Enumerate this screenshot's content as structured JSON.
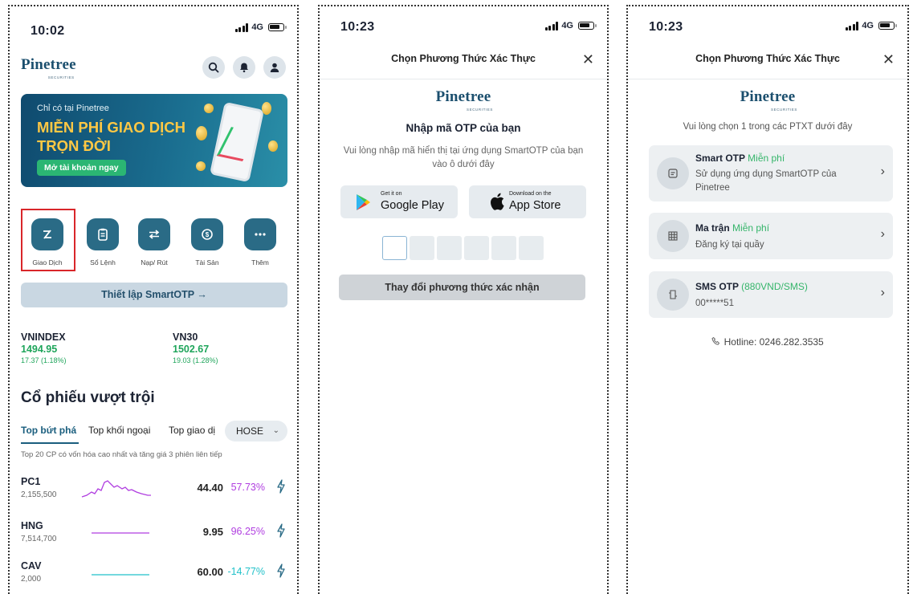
{
  "screen1": {
    "time": "10:02",
    "network": "4G",
    "logo": "Pinetree",
    "logo_sub": "SECURITIES",
    "banner": {
      "line1": "Chỉ có tại Pinetree",
      "line2": "MIỄN PHÍ GIAO DỊCH TRỌN ĐỜI",
      "cta": "Mở tài khoản ngay"
    },
    "quick_actions": [
      {
        "label": "Giao Dịch",
        "icon": "trade-icon"
      },
      {
        "label": "Sổ Lệnh",
        "icon": "order-book-icon"
      },
      {
        "label": "Nạp/ Rút",
        "icon": "transfer-icon"
      },
      {
        "label": "Tài Sản",
        "icon": "assets-icon"
      },
      {
        "label": "Thêm",
        "icon": "more-icon"
      }
    ],
    "smartotp_button": "Thiết lập SmartOTP →",
    "indices": [
      {
        "name": "VNINDEX",
        "value": "1494.95",
        "change": "17.37 (1.18%)"
      },
      {
        "name": "VN30",
        "value": "1502.67",
        "change": "19.03 (1.28%)"
      }
    ],
    "section_title": "Cổ phiếu vượt trội",
    "tabs": [
      "Top bứt phá",
      "Top khối ngoại",
      "Top giao dịch"
    ],
    "exchange": "HOSE",
    "note": "Top 20 CP có vốn hóa cao nhất và tăng giá 3 phiên liên tiếp",
    "stocks": [
      {
        "symbol": "PC1",
        "volume": "2,155,500",
        "price": "44.40",
        "change": "57.73%"
      },
      {
        "symbol": "HNG",
        "volume": "7,514,700",
        "price": "9.95",
        "change": "96.25%"
      },
      {
        "symbol": "CAV",
        "volume": "2,000",
        "price": "60.00",
        "change": "-14.77%"
      }
    ]
  },
  "screen2": {
    "time": "10:23",
    "network": "4G",
    "title": "Chọn Phương Thức Xác Thực",
    "logo": "Pinetree",
    "logo_sub": "SECURITIES",
    "heading": "Nhập mã OTP của bạn",
    "description": "Vui lòng nhập mã hiển thị tại ứng dụng SmartOTP của bạn vào ô dưới đây",
    "google_small": "Get it on",
    "google_large": "Google Play",
    "apple_small": "Download on the",
    "apple_large": "App Store",
    "change_button": "Thay đổi phương thức xác nhận"
  },
  "screen3": {
    "time": "10:23",
    "network": "4G",
    "title": "Chọn Phương Thức Xác Thực",
    "logo": "Pinetree",
    "logo_sub": "SECURITIES",
    "subtitle": "Vui lòng chọn 1 trong các PTXT dưới đây",
    "options": [
      {
        "name": "Smart OTP",
        "price": "Miễn phí",
        "desc": "Sử dụng ứng dụng SmartOTP của Pinetree",
        "icon": "smart-otp-icon"
      },
      {
        "name": "Ma trận",
        "price": "Miễn phí",
        "desc": "Đăng ký tại quầy",
        "icon": "matrix-icon"
      },
      {
        "name": "SMS OTP",
        "price": "(880VND/SMS)",
        "desc": "00*****51",
        "icon": "sms-icon"
      }
    ],
    "hotline": "Hotline: 0246.282.3535"
  },
  "colors": {
    "brand": "#1b4f6e",
    "accent": "#2a6b86",
    "green": "#1fa55b",
    "purple": "#b03ee0",
    "cyan": "#22c1c9",
    "highlight": "#d9262a"
  }
}
